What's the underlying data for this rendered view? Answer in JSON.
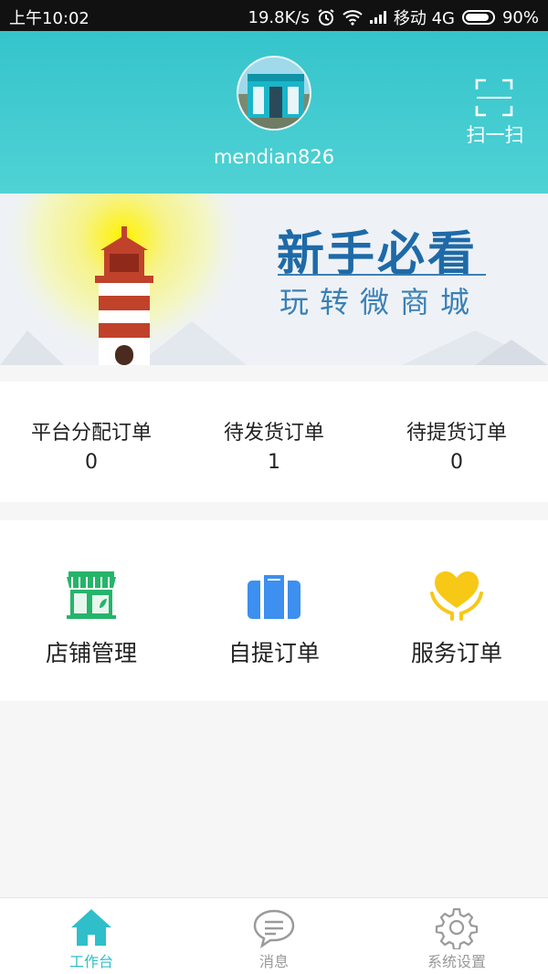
{
  "status_bar": {
    "time": "上午10:02",
    "speed": "19.8K/s",
    "carrier": "移动 4G",
    "battery": "90%",
    "battery_level": 0.9
  },
  "header": {
    "username": "mendian826",
    "scan_label": "扫一扫"
  },
  "banner": {
    "title": "新手必看",
    "subtitle": "玩转微商城"
  },
  "stats": [
    {
      "label": "平台分配订单",
      "value": "0"
    },
    {
      "label": "待发货订单",
      "value": "1"
    },
    {
      "label": "待提货订单",
      "value": "0"
    }
  ],
  "menu": [
    {
      "label": "店铺管理",
      "icon": "store-icon",
      "color": "#26b46a"
    },
    {
      "label": "自提订单",
      "icon": "suitcase-icon",
      "color": "#3d8ff0"
    },
    {
      "label": "服务订单",
      "icon": "heart-hands-icon",
      "color": "#f7c816"
    }
  ],
  "tabs": [
    {
      "label": "工作台",
      "icon": "home-icon",
      "active": true
    },
    {
      "label": "消息",
      "icon": "chat-icon",
      "active": false
    },
    {
      "label": "系统设置",
      "icon": "gear-icon",
      "active": false
    }
  ],
  "colors": {
    "accent": "#2fbfca",
    "header": "#35c4cc"
  }
}
